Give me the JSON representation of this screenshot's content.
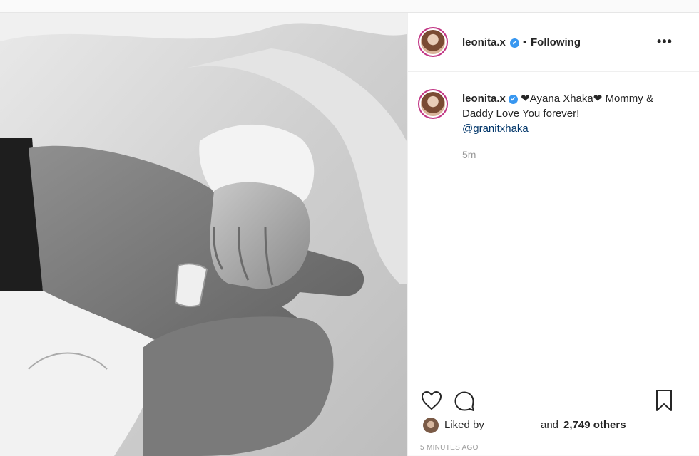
{
  "post": {
    "username": "leonita.x",
    "verified_mark": "✔",
    "separator": "•",
    "follow_status": "Following",
    "more_label": "•••",
    "caption_parts": {
      "text_1": "❤Ayana Xhaka❤ Mommy & Daddy Love You forever!",
      "mention": "@granitxhaka"
    },
    "comment_time": "5m",
    "liked_by_label": "Liked by",
    "others_prefix": "and",
    "others_count": "2,749 others",
    "posted_ago": "5 MINUTES AGO"
  },
  "icons": {
    "like": "heart-icon",
    "comment": "comment-bubble-icon",
    "save": "bookmark-icon",
    "more": "more-options-icon",
    "verified": "verified-badge-icon"
  },
  "colors": {
    "accent_link": "#003569",
    "verified_blue": "#3897f0",
    "story_ring": "#c13584"
  }
}
